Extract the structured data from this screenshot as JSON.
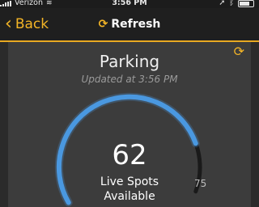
{
  "status_bar": {
    "carrier": "Verizon",
    "time": "3:56 PM",
    "icons": [
      "signal-icon",
      "wifi-icon",
      "location-icon",
      "bluetooth-icon",
      "battery-icon"
    ]
  },
  "nav": {
    "back_label": "Back",
    "refresh_label": "Refresh",
    "accent_color": "#f4b526"
  },
  "card": {
    "title": "Parking",
    "updated": "Updated at 3:56 PM",
    "count": "62",
    "label_line1": "Live Spots",
    "label_line2": "Available",
    "max": "75",
    "gauge": {
      "value": 62,
      "max": 75,
      "arc_color": "#4a98e0",
      "track_color": "#1a1a1a"
    }
  }
}
